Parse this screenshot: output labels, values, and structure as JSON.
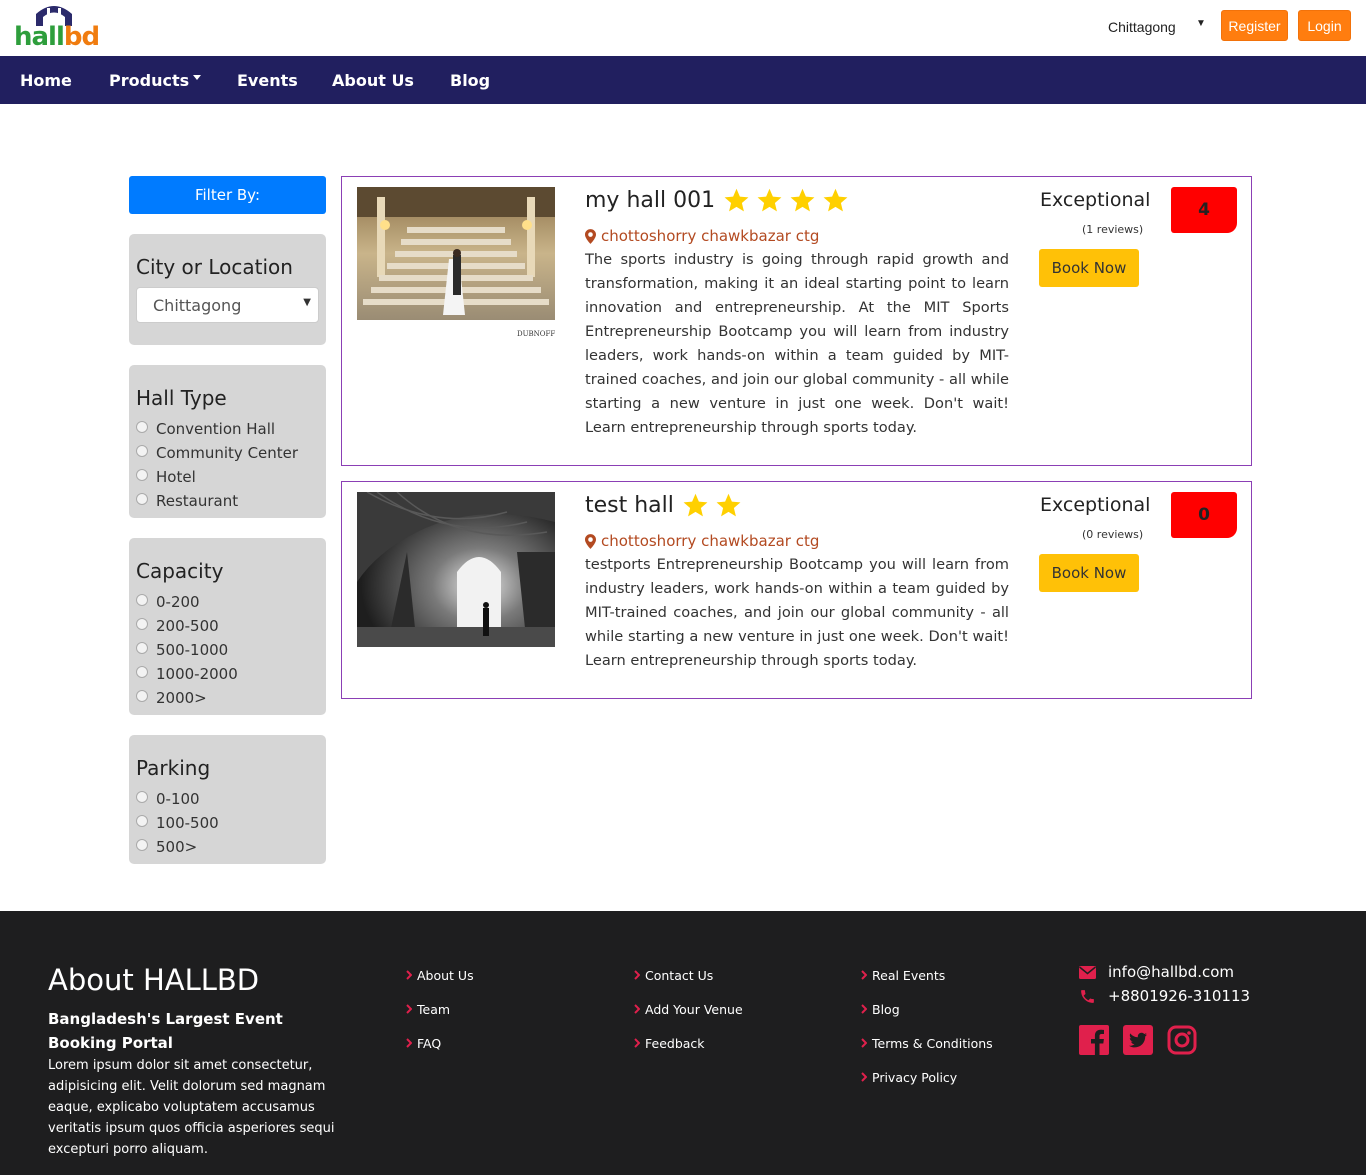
{
  "header": {
    "logo_text_part1": "hall",
    "logo_text_part2": "bd",
    "city": "Chittagong",
    "register_label": "Register",
    "login_label": "Login"
  },
  "nav": {
    "items": [
      {
        "label": "Home"
      },
      {
        "label": "Products"
      },
      {
        "label": "Events"
      },
      {
        "label": "About Us"
      },
      {
        "label": "Blog"
      }
    ]
  },
  "sidebar": {
    "filter_label": "Filter By:",
    "city_title": "City or Location",
    "city_selected": "Chittagong",
    "hall_type_title": "Hall Type",
    "hall_types": [
      "Convention Hall",
      "Community Center",
      "Hotel",
      "Restaurant"
    ],
    "capacity_title": "Capacity",
    "capacities": [
      "0-200",
      "200-500",
      "500-1000",
      "1000-2000",
      "2000>"
    ],
    "parking_title": "Parking",
    "parkings": [
      "0-100",
      "100-500",
      "500>"
    ]
  },
  "halls": [
    {
      "name": "my hall 001",
      "stars": 4,
      "location": "chottoshorry chawkbazar ctg",
      "description": "The sports industry is going through rapid growth and transformation, making it an ideal starting point to learn innovation and entrepreneurship. At the MIT Sports Entrepreneurship Bootcamp you will learn from industry leaders, work hands-on within a team guided by MIT-trained coaches, and join our global community - all while starting a new venture in just one week. Don't wait! Learn entrepreneurship through sports today.",
      "rating_label": "Exceptional",
      "reviews": "(1 reviews)",
      "book_label": "Book Now",
      "score": "4",
      "image_caption": "DUBNOFF"
    },
    {
      "name": "test hall",
      "stars": 2,
      "location": "chottoshorry chawkbazar ctg",
      "description": "testports Entrepreneurship Bootcamp you will learn from industry leaders, work hands-on within a team guided by MIT-trained coaches, and join our global community - all while starting a new venture in just one week. Don't wait! Learn entrepreneurship through sports today.",
      "rating_label": "Exceptional",
      "reviews": "(0 reviews)",
      "book_label": "Book Now",
      "score": "0"
    }
  ],
  "footer": {
    "title": "About HALLBD",
    "tagline": "Bangladesh's Largest Event Booking Portal",
    "about_text": "Lorem ipsum dolor sit amet consectetur, adipisicing elit. Velit dolorum sed magnam eaque, explicabo voluptatem accusamus veritatis ipsum quos officia asperiores sequi excepturi porro aliquam.",
    "col1": [
      "About Us",
      "Team",
      "FAQ"
    ],
    "col2": [
      "Contact Us",
      "Add Your Venue",
      "Feedback"
    ],
    "col3": [
      "Real Events",
      "Blog",
      "Terms & Conditions",
      "Privacy Policy"
    ],
    "email": "info@hallbd.com",
    "phone": "+8801926-310113",
    "social": [
      "facebook-icon",
      "twitter-icon",
      "instagram-icon"
    ]
  },
  "colors": {
    "nav_bg": "#211f5f",
    "orange": "#ff7d0f",
    "filter_blue": "#007bff",
    "book_yellow": "#ffc107",
    "score_red": "#ff0000",
    "card_border": "#8b3fb5",
    "footer_bg": "#1e1e1f",
    "footer_accent": "#e0204c",
    "star": "#ffd000"
  }
}
